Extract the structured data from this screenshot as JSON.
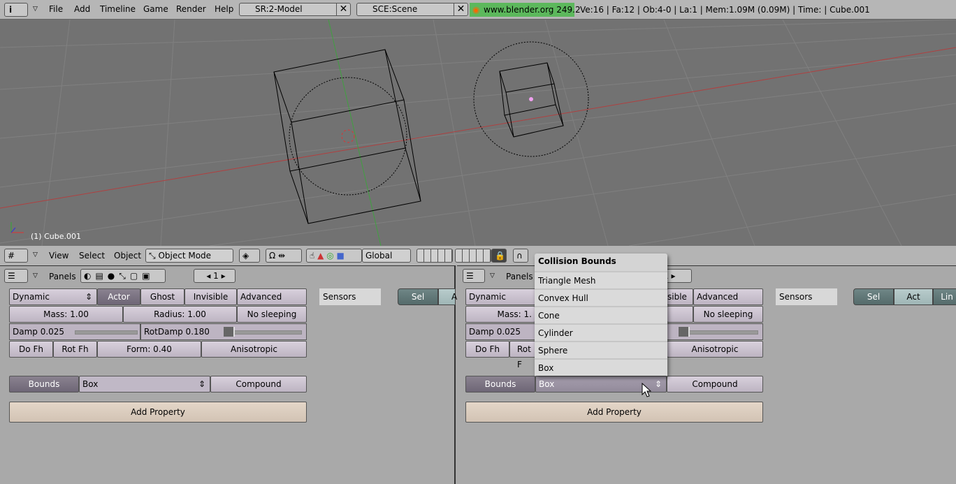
{
  "topbar": {
    "menus": [
      "File",
      "Add",
      "Timeline",
      "Game",
      "Render",
      "Help"
    ],
    "screen": "SR:2-Model",
    "scene": "SCE:Scene",
    "version": "www.blender.org 249.2",
    "stats": "Ve:16 | Fa:12 | Ob:4-0 | La:1  | Mem:1.09M (0.09M)  | Time: | Cube.001"
  },
  "viewport": {
    "object_label": "(1) Cube.001",
    "header": {
      "menus": [
        "View",
        "Select",
        "Object"
      ],
      "mode": "Object Mode",
      "orientation": "Global"
    }
  },
  "left_panel": {
    "header": "Panels",
    "frame": "1",
    "type": "Dynamic",
    "actor": "Actor",
    "ghost": "Ghost",
    "invisible": "Invisible",
    "advanced": "Advanced",
    "mass": "Mass: 1.00",
    "radius": "Radius: 1.00",
    "no_sleeping": "No sleeping",
    "damp": "Damp 0.025",
    "rotdamp": "RotDamp 0.180",
    "dofh": "Do Fh",
    "rotfh": "Rot Fh",
    "form": "Form: 0.40",
    "aniso": "Anisotropic",
    "bounds": "Bounds",
    "bounds_value": "Box",
    "compound": "Compound",
    "add_property": "Add Property",
    "sensors": "Sensors",
    "sel": "Sel",
    "act": "A"
  },
  "right_panel": {
    "header": "Panels",
    "frame": "1",
    "type": "Dynamic",
    "invisible": "sible",
    "advanced": "Advanced",
    "mass": "Mass: 1.",
    "no_sleeping": "No sleeping",
    "damp": "Damp 0.025",
    "dofh": "Do Fh",
    "rotfh": "Rot F",
    "aniso": "Anisotropic",
    "bounds": "Bounds",
    "bounds_value": "Box",
    "compound": "Compound",
    "add_property": "Add Property",
    "sensors": "Sensors",
    "sel": "Sel",
    "act": "Act",
    "link": "Lin"
  },
  "popup": {
    "title": "Collision Bounds",
    "items": [
      "Triangle Mesh",
      "Convex Hull",
      "Cone",
      "Cylinder",
      "Sphere",
      "Box"
    ]
  },
  "colors": {
    "viewport": "#727272",
    "button": "#c9c0cf",
    "active_button": "#7a7282",
    "version_bg": "#5cb85c"
  }
}
